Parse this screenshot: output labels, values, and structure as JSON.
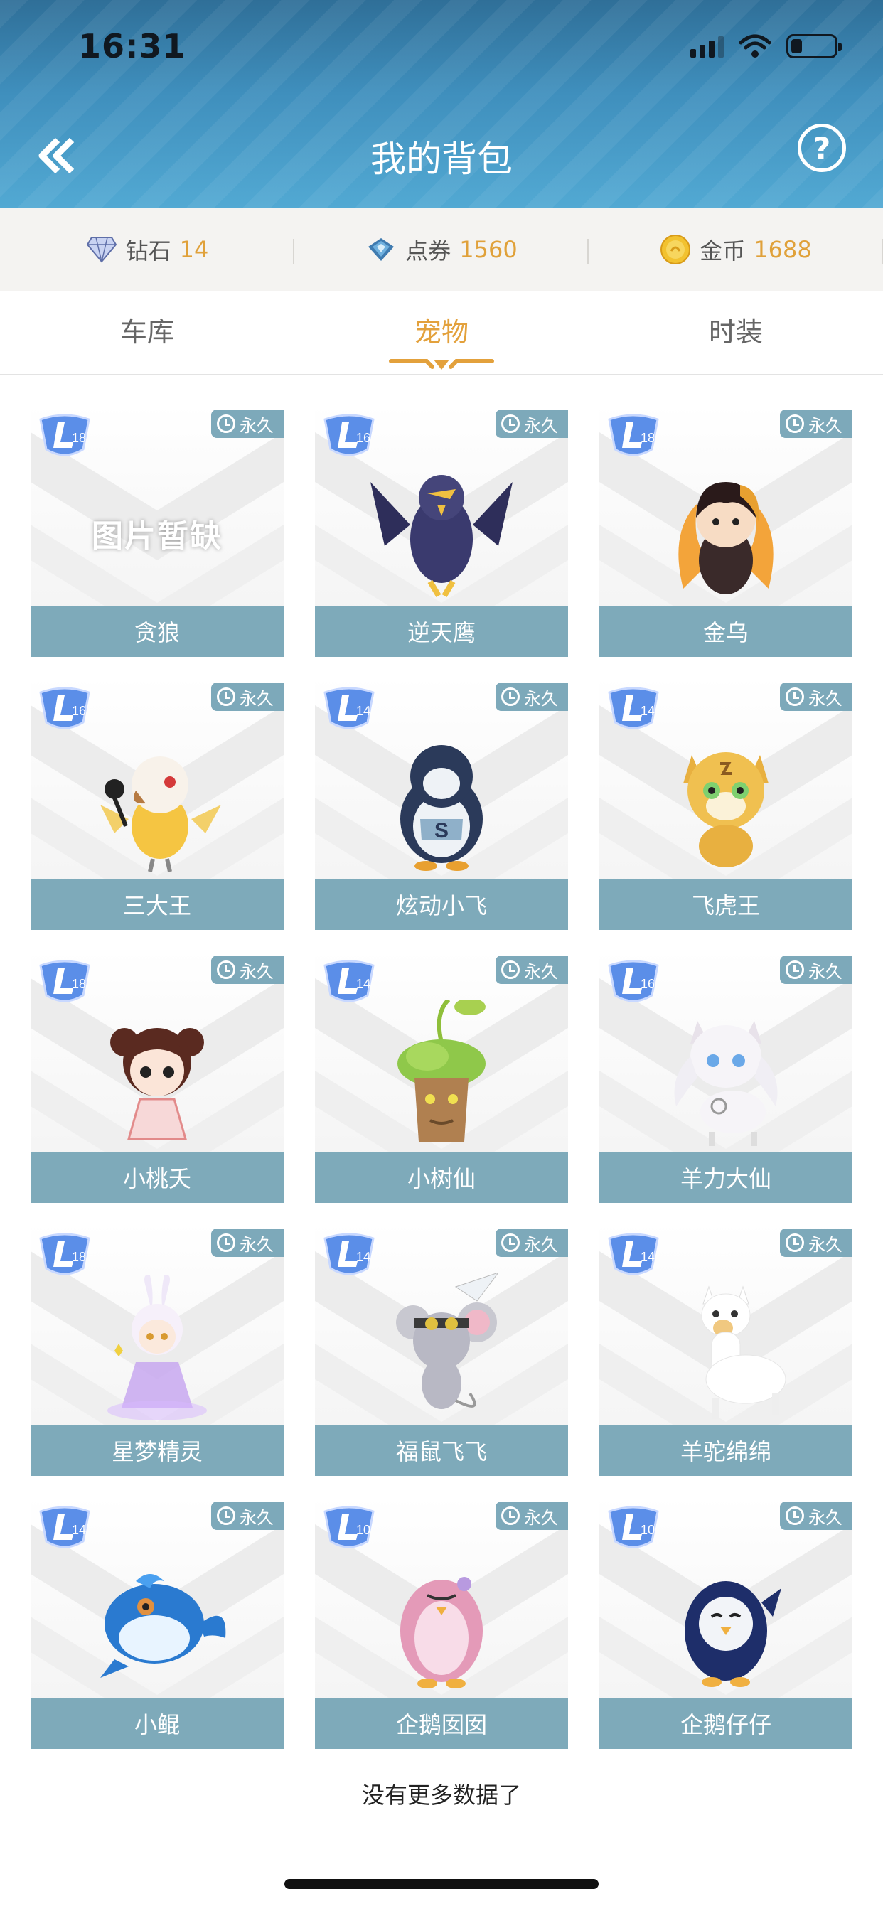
{
  "status_bar": {
    "time": "16:31"
  },
  "header": {
    "title": "我的背包",
    "help_glyph": "?"
  },
  "currency": [
    {
      "label": "钻石",
      "value": "14",
      "icon": "diamond-icon"
    },
    {
      "label": "点券",
      "value": "1560",
      "icon": "coupon-icon"
    },
    {
      "label": "金币",
      "value": "1688",
      "icon": "gold-coin-icon"
    }
  ],
  "tabs": [
    {
      "label": "车库",
      "active": false
    },
    {
      "label": "宠物",
      "active": true
    },
    {
      "label": "时装",
      "active": false
    }
  ],
  "pets": [
    {
      "name": "贪狼",
      "level": "18",
      "tag": "永久",
      "placeholder": "图片暂缺",
      "art": "none"
    },
    {
      "name": "逆天鹰",
      "level": "16",
      "tag": "永久",
      "art": "eagle"
    },
    {
      "name": "金乌",
      "level": "18",
      "tag": "永久",
      "art": "fire"
    },
    {
      "name": "三大王",
      "level": "16",
      "tag": "永久",
      "art": "bird"
    },
    {
      "name": "炫动小飞",
      "level": "14",
      "tag": "永久",
      "art": "penguin"
    },
    {
      "name": "飞虎王",
      "level": "14",
      "tag": "永久",
      "art": "tiger"
    },
    {
      "name": "小桃夭",
      "level": "18",
      "tag": "永久",
      "art": "girl"
    },
    {
      "name": "小树仙",
      "level": "14",
      "tag": "永久",
      "art": "tree"
    },
    {
      "name": "羊力大仙",
      "level": "16",
      "tag": "永久",
      "art": "goat"
    },
    {
      "name": "星梦精灵",
      "level": "18",
      "tag": "永久",
      "art": "fairy"
    },
    {
      "name": "福鼠飞飞",
      "level": "14",
      "tag": "永久",
      "art": "mouse"
    },
    {
      "name": "羊驼绵绵",
      "level": "14",
      "tag": "永久",
      "art": "alpaca"
    },
    {
      "name": "小鲲",
      "level": "14",
      "tag": "永久",
      "art": "whale"
    },
    {
      "name": "企鹅囡囡",
      "level": "10",
      "tag": "永久",
      "art": "pink-penguin"
    },
    {
      "name": "企鹅仔仔",
      "level": "10",
      "tag": "永久",
      "art": "blue-penguin"
    }
  ],
  "footer": {
    "no_more_text": "没有更多数据了"
  },
  "colors": {
    "accent": "#e3a13c",
    "name_bar": "#7eaaba",
    "header": "#3f8fbd"
  }
}
